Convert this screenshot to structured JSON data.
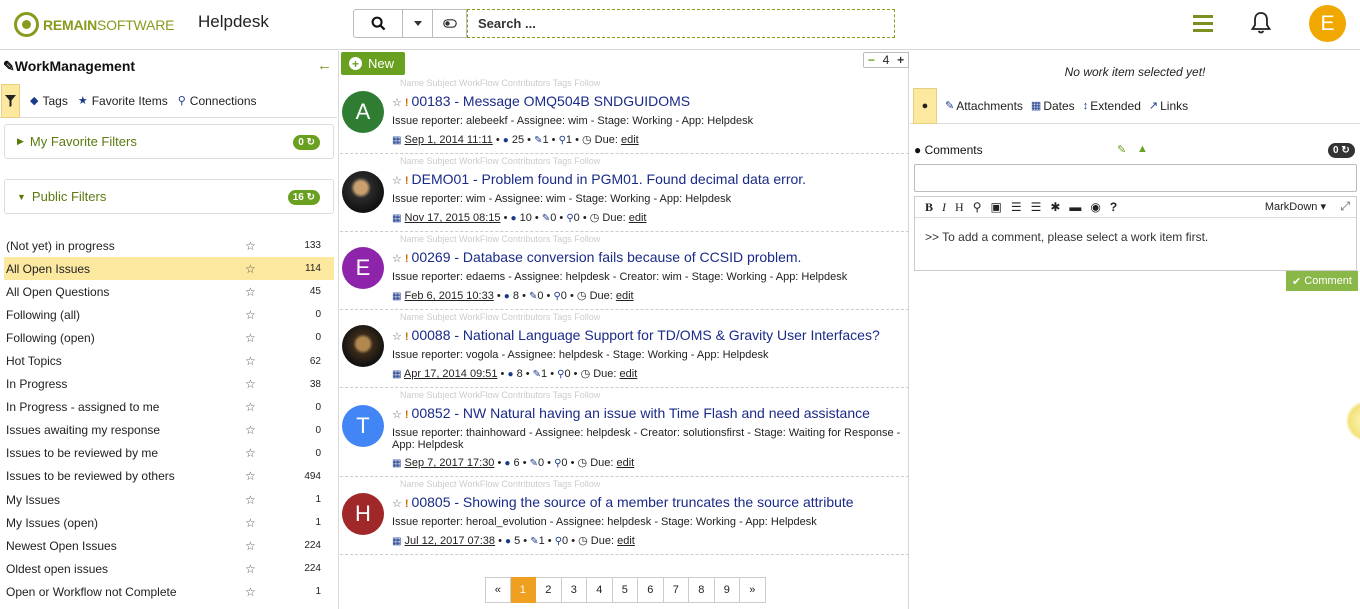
{
  "header": {
    "logo_bold": "REMAIN",
    "logo_rest": "SOFTWARE",
    "app_name": "Helpdesk",
    "search_placeholder": "Search ...",
    "user_initial": "E"
  },
  "left": {
    "title": "WorkManagement",
    "tabs": [
      "Tags",
      "Favorite Items",
      "Connections"
    ],
    "favorite_filters": {
      "label": "My Favorite Filters",
      "count": "0"
    },
    "public_filters": {
      "label": "Public Filters",
      "count": "16"
    },
    "filters": [
      {
        "label": "(Not yet) in progress",
        "count": "133"
      },
      {
        "label": "All Open Issues",
        "count": "114"
      },
      {
        "label": "All Open Questions",
        "count": "45"
      },
      {
        "label": "Following (all)",
        "count": "0"
      },
      {
        "label": "Following (open)",
        "count": "0"
      },
      {
        "label": "Hot Topics",
        "count": "62"
      },
      {
        "label": "In Progress",
        "count": "38"
      },
      {
        "label": "In Progress - assigned to me",
        "count": "0"
      },
      {
        "label": "Issues awaiting my response",
        "count": "0"
      },
      {
        "label": "Issues to be reviewed by me",
        "count": "0"
      },
      {
        "label": "Issues to be reviewed by others",
        "count": "494"
      },
      {
        "label": "My Issues",
        "count": "1"
      },
      {
        "label": "My Issues (open)",
        "count": "1"
      },
      {
        "label": "Newest Open Issues",
        "count": "224"
      },
      {
        "label": "Oldest open issues",
        "count": "224"
      },
      {
        "label": "Open or Workflow not Complete",
        "count": "1"
      }
    ]
  },
  "middle": {
    "new_label": "New",
    "zoom_value": "4",
    "item_actions": "Name  Subject  WorkFlow  Contributors  Tags  Follow",
    "items": [
      {
        "initial": "A",
        "color": "#2e7d32",
        "title": "00183 - Message OMQ504B SNDGUIDOMS",
        "meta": "Issue reporter: alebeekf - Assignee: wim - Stage: Working - App: Helpdesk",
        "date": "Sep 1, 2014 11:11",
        "comments": "25",
        "att": "1",
        "links": "1"
      },
      {
        "initial": "",
        "color": "#444",
        "title": "DEMO01 - Problem found in PGM01. Found decimal data error.",
        "meta": "Issue reporter: wim - Assignee: wim - Stage: Working - App: Helpdesk",
        "date": "Nov 17, 2015 08:15",
        "comments": "10",
        "att": "0",
        "links": "0"
      },
      {
        "initial": "E",
        "color": "#8e24aa",
        "title": "00269 - Database conversion fails because of CCSID problem.",
        "meta": "Issue reporter: edaems - Assignee: helpdesk - Creator: wim - Stage: Working - App: Helpdesk",
        "date": "Feb 6, 2015 10:33",
        "comments": "8",
        "att": "0",
        "links": "0"
      },
      {
        "initial": "",
        "color": "#333",
        "title": "00088 - National Language Support for TD/OMS & Gravity User Interfaces?",
        "meta": "Issue reporter: vogola - Assignee: helpdesk - Stage: Working - App: Helpdesk",
        "date": "Apr 17, 2014 09:51",
        "comments": "8",
        "att": "1",
        "links": "0"
      },
      {
        "initial": "T",
        "color": "#4285f4",
        "title": "00852 - NW Natural having an issue with Time Flash and need assistance",
        "meta": "Issue reporter: thainhoward - Assignee: helpdesk - Creator: solutionsfirst - Stage: Waiting for Response -",
        "meta2": "App: Helpdesk",
        "date": "Sep 7, 2017 17:30",
        "comments": "6",
        "att": "0",
        "links": "0"
      },
      {
        "initial": "H",
        "color": "#a02828",
        "title": "00805 - Showing the source of a member truncates the source attribute",
        "meta": "Issue reporter: heroal_evolution - Assignee: helpdesk - Stage: Working - App: Helpdesk",
        "date": "Jul 12, 2017 07:38",
        "comments": "5",
        "att": "1",
        "links": "0"
      }
    ],
    "due_label": "Due:",
    "due_edit": "edit",
    "pages": [
      "«",
      "1",
      "2",
      "3",
      "4",
      "5",
      "6",
      "7",
      "8",
      "9",
      "»"
    ],
    "current_page": "1"
  },
  "right": {
    "no_selection": "No work item selected yet!",
    "tabs": [
      "Attachments",
      "Dates",
      "Extended",
      "Links"
    ],
    "comments_label": "Comments",
    "comments_count": "0",
    "editor_mode": "MarkDown",
    "editor_placeholder": ">> To add a comment, please select a work item first.",
    "comment_button": "Comment"
  },
  "colors": {
    "brand": "#8a9a1e",
    "accent_green": "#6aa020",
    "active_yellow": "#fde8a0",
    "page_active": "#f0a020"
  }
}
